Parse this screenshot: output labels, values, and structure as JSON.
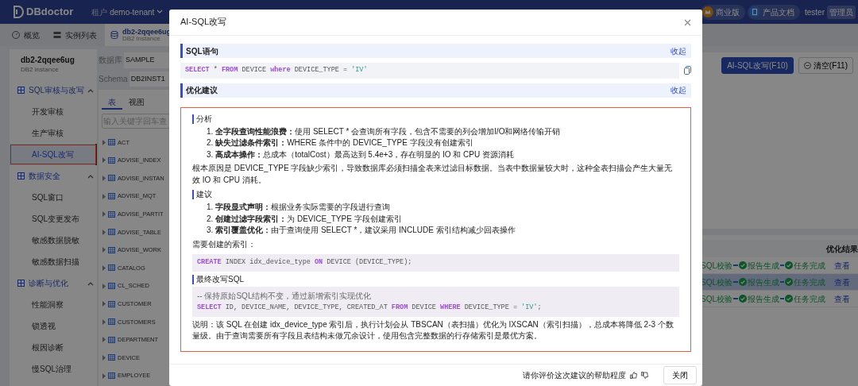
{
  "top_bar": {
    "logo": "DBdoctor",
    "tenant_label": "租户",
    "tenant": "demo-tenant",
    "links": [
      {
        "label": "商业版",
        "kind": "edition"
      },
      {
        "label": "产品文档",
        "kind": "docs"
      }
    ],
    "user": "tester",
    "role": "管理员"
  },
  "page_tabs": [
    {
      "label": "概览",
      "kind": "overview",
      "selected": false
    },
    {
      "label": "实例列表",
      "kind": "list",
      "selected": false
    },
    {
      "label": "db2-2qqee6ug",
      "subtitle": "DB2 instance",
      "kind": "database",
      "selected": true
    }
  ],
  "sidebar": {
    "title": "db2-2qqee6ug",
    "subtitle": "DB2 instance",
    "groups": [
      {
        "label": "SQL审核与改写",
        "expanded": true,
        "children": [
          {
            "label": "开发审核",
            "selected": false,
            "highlighted": false
          },
          {
            "label": "生产审核",
            "selected": false,
            "highlighted": false
          },
          {
            "label": "AI-SQL改写",
            "selected": true,
            "highlighted": true
          }
        ]
      },
      {
        "label": "数据安全",
        "expanded": true,
        "children": [
          {
            "label": "SQL窗口",
            "selected": false,
            "highlighted": false
          },
          {
            "label": "SQL变更发布",
            "selected": false,
            "highlighted": false
          },
          {
            "label": "敏感数据脱敏",
            "selected": false,
            "highlighted": false
          },
          {
            "label": "敏感数据扫描",
            "selected": false,
            "highlighted": false
          }
        ]
      },
      {
        "label": "诊断与优化",
        "expanded": true,
        "children": [
          {
            "label": "性能洞察",
            "selected": false,
            "highlighted": false
          },
          {
            "label": "锁透视",
            "selected": false,
            "highlighted": false
          },
          {
            "label": "根因诊断",
            "selected": false,
            "highlighted": false
          },
          {
            "label": "慢SQL治理",
            "selected": false,
            "highlighted": false
          }
        ]
      }
    ]
  },
  "db_panel": {
    "fields": [
      {
        "label": "数据库",
        "value": "SAMPLE"
      },
      {
        "label": "Schema",
        "value": "DB2INST1"
      }
    ],
    "tabs": [
      {
        "label": "表",
        "selected": true
      },
      {
        "label": "视图",
        "selected": false
      }
    ],
    "search": {
      "placeholder": "输入关键字回车查"
    },
    "tables": [
      "ACT",
      "ADVISE_INDEX",
      "ADVISE_INSTAN",
      "ADVISE_MQT",
      "ADVISE_PARTIT",
      "ADVISE_TABLE",
      "ADVISE_WORK",
      "CATALOG",
      "CL_SCHED",
      "CUSTOMER",
      "CUSTOMERS",
      "DEPARTMENT",
      "DEVICE",
      "EMPLOYEE"
    ]
  },
  "toolbar": {
    "buttons": [
      {
        "label": "AI-SQL改写(F10)",
        "kind": "primary"
      },
      {
        "label": "清空(F11)",
        "kind": "clear"
      }
    ]
  },
  "task_table": {
    "columns": [
      "优化结果"
    ],
    "rows": [
      {
        "steps": [
          {
            "label": "SQL校验",
            "kind": "plain"
          },
          {
            "label": "报告生成",
            "kind": "done"
          },
          {
            "label": "任务完成",
            "kind": "done"
          }
        ],
        "action": "查看",
        "selected": false
      },
      {
        "steps": [
          {
            "label": "SQL校验",
            "kind": "plain"
          },
          {
            "label": "报告生成",
            "kind": "done"
          },
          {
            "label": "任务完成",
            "kind": "done"
          }
        ],
        "action": "查看",
        "selected": true
      },
      {
        "steps": [
          {
            "label": "SQL校验",
            "kind": "plain"
          },
          {
            "label": "报告生成",
            "kind": "done"
          },
          {
            "label": "任务完成",
            "kind": "done"
          }
        ],
        "action": "查看",
        "selected": false
      }
    ]
  },
  "modal": {
    "title": "AI-SQL改写",
    "sections": [
      {
        "title": "SQL语句",
        "toggle": "收起",
        "kind": "code",
        "code": [
          [
            {
              "text": "SELECT",
              "kind": "keyword"
            },
            {
              "text": " * ",
              "kind": "plain"
            },
            {
              "text": "FROM",
              "kind": "keyword"
            },
            {
              "text": " DEVICE ",
              "kind": "plain"
            },
            {
              "text": "where",
              "kind": "keyword"
            },
            {
              "text": " DEVICE_TYPE = ",
              "kind": "plain"
            },
            {
              "text": "'IV'",
              "kind": "string"
            }
          ]
        ]
      },
      {
        "title": "优化建议",
        "toggle": "收起",
        "kind": "advice",
        "highlighted": true,
        "blocks": [
          {
            "kind": "heading",
            "text": "分析"
          },
          {
            "kind": "list",
            "items": [
              {
                "number": "1.",
                "label": "全字段查询性能浪费：",
                "text": "使用 SELECT * 会查询所有字段，包含不需要的列会增加I/O和网络传输开销"
              },
              {
                "number": "2.",
                "label": "缺失过滤条件索引：",
                "text": "WHERE 条件中的 DEVICE_TYPE 字段没有创建索引"
              },
              {
                "number": "3.",
                "label": "高成本操作：",
                "text": "总成本（totalCost）最高达到 5.4e+3，存在明显的 IO 和 CPU 资源消耗"
              }
            ]
          },
          {
            "kind": "paragraph",
            "text": "根本原因是 DEVICE_TYPE 字段缺少索引，导致数据库必须扫描全表来过滤目标数据。当表中数据量较大时，这种全表扫描会产生大量无效 IO 和 CPU 消耗。"
          },
          {
            "kind": "heading",
            "text": "建议"
          },
          {
            "kind": "list",
            "items": [
              {
                "number": "1.",
                "label": "字段显式声明：",
                "text": "根据业务实际需要的字段进行查询"
              },
              {
                "number": "2.",
                "label": "创建过滤字段索引：",
                "text": "为 DEVICE_TYPE 字段创建索引"
              },
              {
                "number": "3.",
                "label": "索引覆盖优化：",
                "text": "由于查询使用 SELECT *，建议采用 INCLUDE 索引结构减少回表操作"
              }
            ]
          },
          {
            "kind": "paragraph",
            "text": "需要创建的索引："
          },
          {
            "kind": "code",
            "lines": [
              [
                {
                  "text": "CREATE",
                  "kind": "keyword"
                },
                {
                  "text": " INDEX idx_device_type ",
                  "kind": "plain"
                },
                {
                  "text": "ON",
                  "kind": "keyword"
                },
                {
                  "text": " DEVICE (DEVICE_TYPE);",
                  "kind": "plain"
                }
              ]
            ]
          },
          {
            "kind": "heading",
            "text": "最终改写SQL"
          },
          {
            "kind": "code",
            "lines": [
              [
                {
                  "text": "-- 保持原始SQL结构不变，通过新增索引实现优化",
                  "kind": "comment"
                }
              ],
              [
                {
                  "text": "SELECT",
                  "kind": "keyword"
                },
                {
                  "text": " ID, DEVICE_NAME, DEVICE_TYPE, CREATED_AT ",
                  "kind": "plain"
                },
                {
                  "text": "FROM",
                  "kind": "keyword"
                },
                {
                  "text": " DEVICE ",
                  "kind": "plain"
                },
                {
                  "text": "WHERE",
                  "kind": "keyword"
                },
                {
                  "text": " DEVICE_TYPE = ",
                  "kind": "plain"
                },
                {
                  "text": "'IV'",
                  "kind": "string"
                },
                {
                  "text": ";",
                  "kind": "plain"
                }
              ]
            ]
          },
          {
            "kind": "paragraph",
            "text": "说明：该 SQL 在创建 idx_device_type 索引后，执行计划会从 TBSCAN（表扫描）优化为 IXSCAN（索引扫描），总成本将降低 2-3 个数量级。由于查询需要所有字段且表结构未做冗余设计，使用包含完整数据的行存储索引是最优方案。"
          }
        ]
      }
    ],
    "feedback": "请你评价这次建议的帮助程度",
    "close": "关闭"
  }
}
